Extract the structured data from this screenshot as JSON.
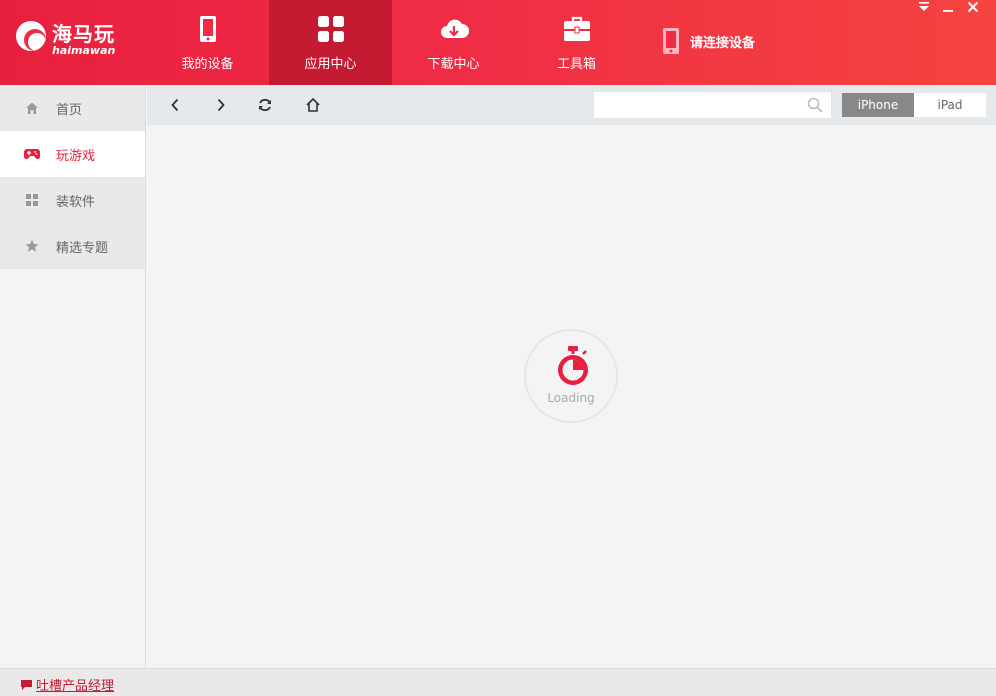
{
  "app": {
    "logo_cn": "海马玩",
    "logo_en": "haimawan"
  },
  "nav": {
    "tabs": [
      {
        "label": "我的设备",
        "icon": "phone-icon",
        "active": false
      },
      {
        "label": "应用中心",
        "icon": "grid-icon",
        "active": true
      },
      {
        "label": "下载中心",
        "icon": "cloud-download-icon",
        "active": false
      },
      {
        "label": "工具箱",
        "icon": "toolbox-icon",
        "active": false
      }
    ],
    "connect_label": "请连接设备"
  },
  "sidebar": {
    "items": [
      {
        "label": "首页",
        "icon": "home-icon",
        "active": false
      },
      {
        "label": "玩游戏",
        "icon": "gamepad-icon",
        "active": true
      },
      {
        "label": "装软件",
        "icon": "apps-icon",
        "active": false
      },
      {
        "label": "精选专题",
        "icon": "star-icon",
        "active": false
      }
    ]
  },
  "toolbar": {
    "search_value": "",
    "search_placeholder": "",
    "device_options": [
      "iPhone",
      "iPad"
    ],
    "selected_device": "iPhone"
  },
  "content": {
    "loading_text": "Loading"
  },
  "footer": {
    "feedback_label": "吐槽产品经理"
  },
  "colors": {
    "brand": "#e8203f",
    "active_tab": "#c41a32",
    "toggle_on": "#888888"
  }
}
